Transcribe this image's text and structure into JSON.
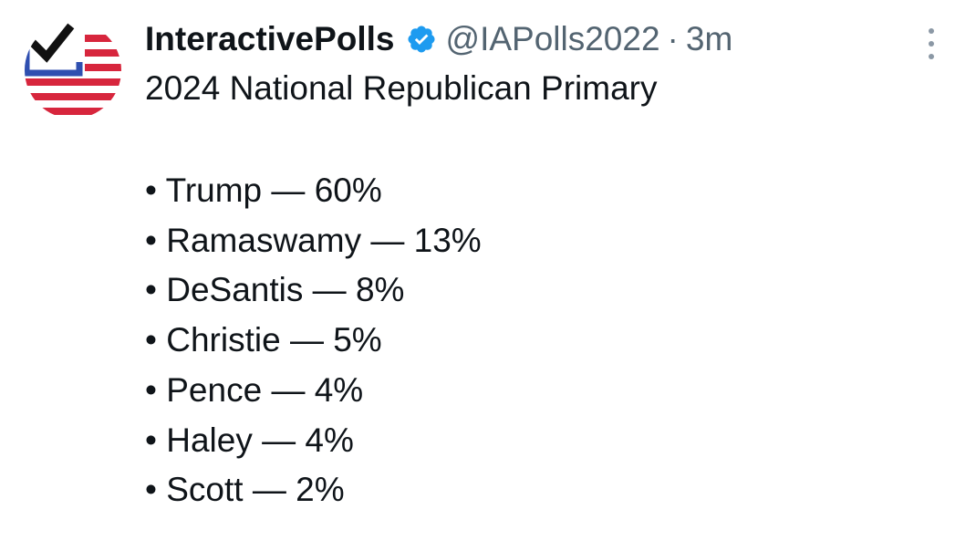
{
  "tweet": {
    "author": {
      "display_name": "InteractivePolls",
      "verified": true,
      "handle": "@IAPolls2022",
      "separator": "·",
      "time": "3m"
    },
    "text": "2024 National Republican Primary",
    "results": [
      {
        "bullet": "•",
        "candidate": "Trump",
        "dash": "—",
        "value": "60%"
      },
      {
        "bullet": "•",
        "candidate": "Ramaswamy",
        "dash": "—",
        "value": "13%"
      },
      {
        "bullet": "•",
        "candidate": "DeSantis",
        "dash": "—",
        "value": "8%"
      },
      {
        "bullet": "•",
        "candidate": "Christie",
        "dash": "—",
        "value": "5%"
      },
      {
        "bullet": "•",
        "candidate": "Pence",
        "dash": "—",
        "value": "4%"
      },
      {
        "bullet": "•",
        "candidate": "Haley",
        "dash": "—",
        "value": "4%"
      },
      {
        "bullet": "•",
        "candidate": "Scott",
        "dash": "—",
        "value": "2%"
      }
    ]
  },
  "icons": {
    "avatar": "flag-checkmark-logo",
    "verified": "verified-badge-icon",
    "more": "more-options-icon"
  },
  "colors": {
    "name": "#0f1419",
    "secondary": "#536471",
    "verified_blue": "#1d9bf0",
    "flag_red": "#d7263d",
    "flag_blue": "#2f4fb0"
  }
}
